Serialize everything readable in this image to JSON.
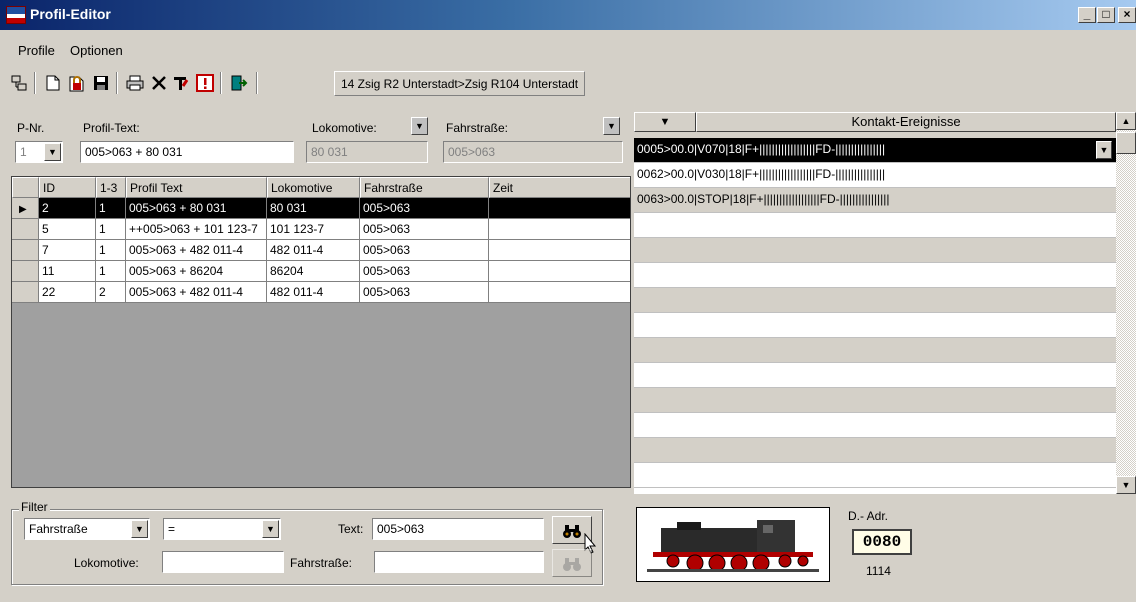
{
  "window": {
    "title": "Profil-Editor"
  },
  "menu": [
    {
      "label": "Profile"
    },
    {
      "label": "Optionen"
    }
  ],
  "toolbar": {
    "route_label": "14 Zsig R2 Unterstadt>Zsig R104 Unterstadt"
  },
  "form": {
    "pnr_label": "P-Nr.",
    "pnr_value": "1",
    "profiltext_label": "Profil-Text:",
    "profiltext_value": "005>063 + 80 031",
    "lok_label": "Lokomotive:",
    "lok_value": "80 031",
    "fahrstrasse_label": "Fahrstraße:",
    "fahrstrasse_value": "005>063"
  },
  "grid": {
    "columns": [
      "ID",
      "1-3",
      "Profil Text",
      "Lokomotive",
      "Fahrstraße",
      "Zeit"
    ],
    "rows": [
      {
        "id": "2",
        "c13": "1",
        "text": "005>063 + 80 031",
        "lok": "80 031",
        "fs": "005>063",
        "zeit": ""
      },
      {
        "id": "5",
        "c13": "1",
        "text": "++005>063 + 101 123-7",
        "lok": "101 123-7",
        "fs": "005>063",
        "zeit": ""
      },
      {
        "id": "7",
        "c13": "1",
        "text": "005>063 + 482 011-4",
        "lok": "482 011-4",
        "fs": "005>063",
        "zeit": ""
      },
      {
        "id": "11",
        "c13": "1",
        "text": "005>063 + 86204",
        "lok": "86204",
        "fs": "005>063",
        "zeit": ""
      },
      {
        "id": "22",
        "c13": "2",
        "text": "005>063 + 482 011-4",
        "lok": "482 011-4",
        "fs": "005>063",
        "zeit": ""
      }
    ]
  },
  "kontakt": {
    "header": "Kontakt-Ereignisse",
    "rows": [
      "0005>00.0|V070|18|F+||||||||||||||||||FD-||||||||||||||||",
      "0062>00.0|V030|18|F+||||||||||||||||||FD-||||||||||||||||",
      "0063>00.0|STOP|18|F+||||||||||||||||||FD-||||||||||||||||"
    ]
  },
  "filter": {
    "legend": "Filter",
    "field_value": "Fahrstraße",
    "operator_value": "=",
    "text_label": "Text:",
    "text_value": "005>063",
    "lok_label": "Lokomotive:",
    "lok_value": "",
    "fs_label": "Fahrstraße:",
    "fs_value": ""
  },
  "locomotive": {
    "dadr_label": "D.- Adr.",
    "dadr_value": "0080",
    "number": "1114"
  }
}
